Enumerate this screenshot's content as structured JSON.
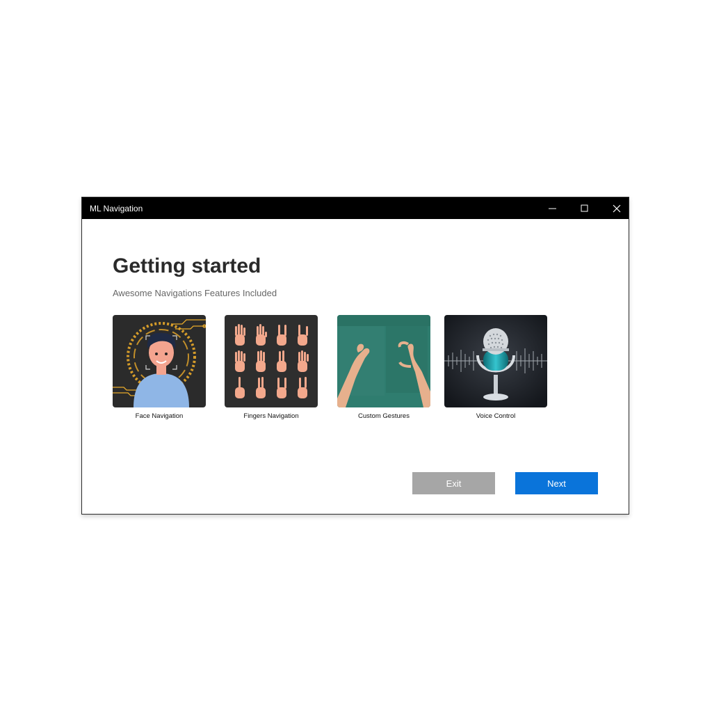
{
  "window": {
    "title": "ML Navigation",
    "controls": [
      "minimize-icon",
      "maximize-icon",
      "close-icon"
    ]
  },
  "page": {
    "heading": "Getting started",
    "subtitle": "Awesome Navigations Features Included"
  },
  "features": [
    {
      "label": "Face Navigation",
      "image": "face-scan-illustration"
    },
    {
      "label": "Fingers Navigation",
      "image": "hand-gestures-grid"
    },
    {
      "label": "Custom Gestures",
      "image": "hands-gesture-photo"
    },
    {
      "label": "Voice Control",
      "image": "microphone-soundwave"
    }
  ],
  "buttons": {
    "exit": "Exit",
    "next": "Next"
  },
  "colors": {
    "titlebar": "#000000",
    "accent": "#0a74da",
    "exit_button": "#a6a6a6"
  }
}
